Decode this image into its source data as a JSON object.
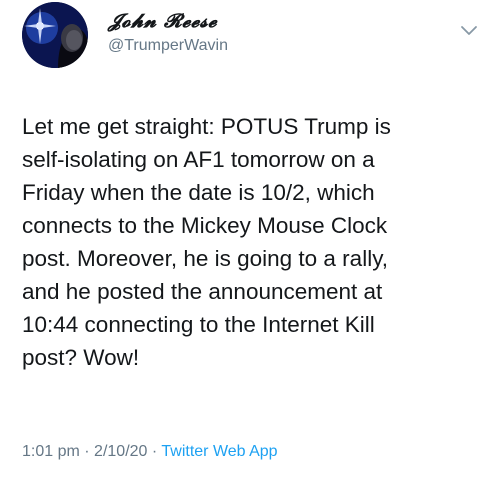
{
  "user": {
    "display_name": "𝓙𝓸𝓱𝓷 𝓡𝓮𝓮𝓼𝓮",
    "handle": "@TrumperWavin"
  },
  "tweet": {
    "lines": [
      "Let me get straight: POTUS Trump is",
      "self-isolating on AF1 tomorrow on a",
      "Friday when the date is 10/2, which",
      "connects to the Mickey Mouse Clock",
      "post. Moreover, he is going to a rally,",
      "and he posted the announcement at",
      "10:44 connecting to the Internet Kill",
      "post? Wow!"
    ]
  },
  "meta": {
    "time": "1:01 pm",
    "separator": "·",
    "date": "2/10/20",
    "source": "Twitter Web App"
  },
  "icons": {
    "menu": "chevron-down-icon",
    "avatar": "avatar"
  },
  "colors": {
    "text": "#14171a",
    "secondary": "#657786",
    "link": "#1da1f2"
  }
}
